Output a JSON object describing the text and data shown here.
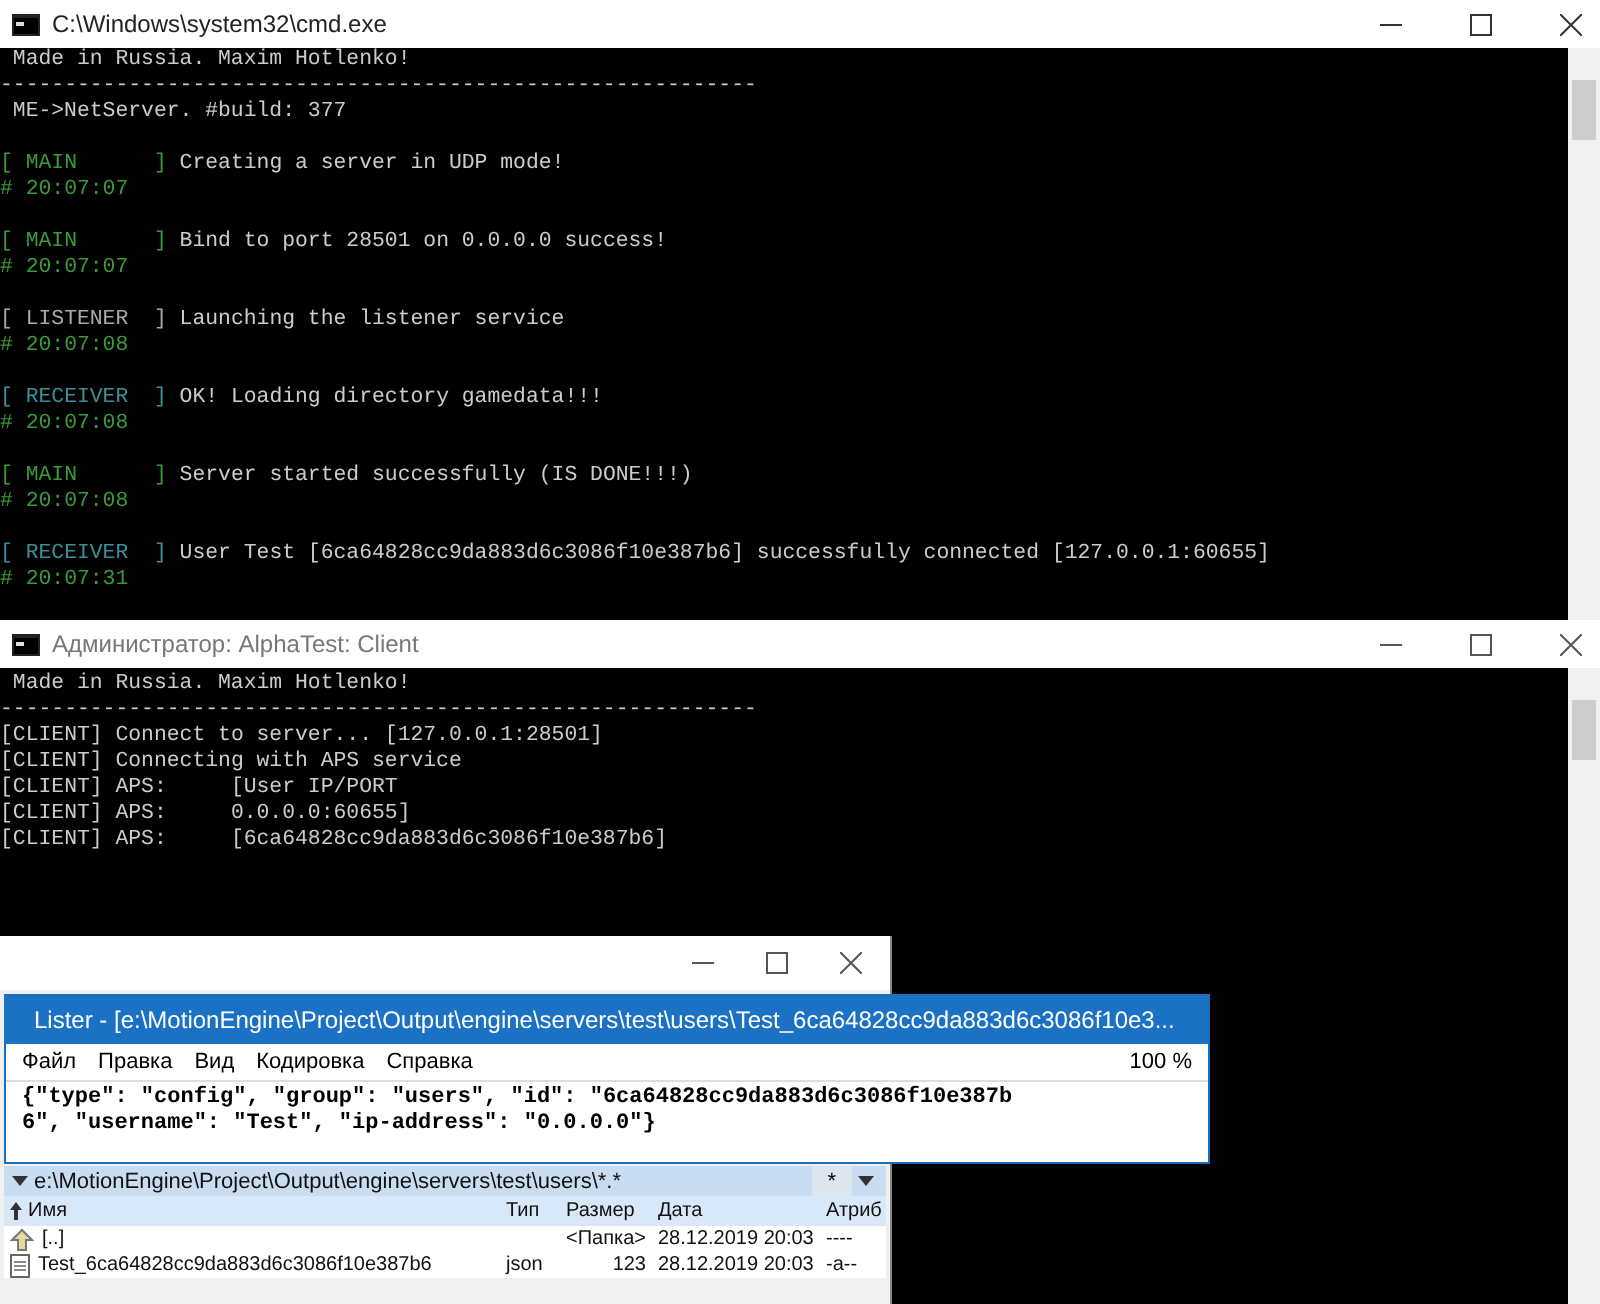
{
  "server_window": {
    "title": "C:\\Windows\\system32\\cmd.exe",
    "lines": [
      {
        "kind": "text",
        "text": "Made in Russia. Maxim Hotlenko!"
      },
      {
        "kind": "rule",
        "text": "-----------------------------------------------------------"
      },
      {
        "kind": "text",
        "text": "ME->NetServer. #build: 377"
      },
      {
        "kind": "log",
        "tag": "[ MAIN      ]",
        "color": "#3a9a3a",
        "message": "Creating a server in UDP mode!",
        "time": "# 20:07:07"
      },
      {
        "kind": "log",
        "tag": "[ MAIN      ]",
        "color": "#3a9a3a",
        "message": "Bind to port 28501 on 0.0.0.0 success!",
        "time": "# 20:07:07"
      },
      {
        "kind": "log",
        "tag": "[ LISTENER  ]",
        "color": "#a8a8a8",
        "message": "Launching the listener service",
        "time": "# 20:07:08"
      },
      {
        "kind": "log",
        "tag": "[ RECEIVER  ]",
        "color": "#3a8f9a",
        "message": "OK! Loading directory gamedata!!!",
        "time": "# 20:07:08"
      },
      {
        "kind": "log",
        "tag": "[ MAIN      ]",
        "color": "#3a9a3a",
        "message": "Server started successfully (IS DONE!!!)",
        "time": "# 20:07:08"
      },
      {
        "kind": "log",
        "tag": "[ RECEIVER  ]",
        "color": "#3a8f9a",
        "message": "User Test [6ca64828cc9da883d6c3086f10e387b6] successfully connected [127.0.0.1:60655]",
        "time": "# 20:07:31"
      }
    ]
  },
  "client_window": {
    "title": "Администратор:  AlphaTest: Client",
    "lines": [
      {
        "kind": "text",
        "text": "Made in Russia. Maxim Hotlenko!"
      },
      {
        "kind": "rule",
        "text": "-----------------------------------------------------------"
      },
      {
        "kind": "plain",
        "text": "[CLIENT] Connect to server... [127.0.0.1:28501]"
      },
      {
        "kind": "plain",
        "text": "[CLIENT] Connecting with APS service"
      },
      {
        "kind": "plain",
        "text": "[CLIENT] APS:     [User IP/PORT"
      },
      {
        "kind": "plain",
        "text": "[CLIENT] APS:     0.0.0.0:60655]"
      },
      {
        "kind": "plain",
        "text": "[CLIENT] APS:     [6ca64828cc9da883d6c3086f10e387b6]"
      }
    ]
  },
  "file_manager": {
    "path": "e:\\MotionEngine\\Project\\Output\\engine\\servers\\test\\users\\*.*",
    "filter_button": "*",
    "columns": [
      "Имя",
      "Тип",
      "Размер",
      "Дата",
      "Атриб"
    ],
    "rows": [
      {
        "kind": "up",
        "name": "[..]",
        "type": "",
        "size": "<Папка>",
        "date": "28.12.2019 20:03",
        "attributes": "----"
      },
      {
        "kind": "file",
        "name": "Test_6ca64828cc9da883d6c3086f10e387b6",
        "type": "json",
        "size": "123",
        "date": "28.12.2019 20:03",
        "attributes": "-a--"
      }
    ]
  },
  "lister": {
    "title": "Lister - [e:\\MotionEngine\\Project\\Output\\engine\\servers\\test\\users\\Test_6ca64828cc9da883d6c3086f10e3...",
    "menu": [
      "Файл",
      "Правка",
      "Вид",
      "Кодировка",
      "Справка"
    ],
    "zoom": "100 %",
    "content": [
      "{\"type\": \"config\", \"group\": \"users\", \"id\": \"6ca64828cc9da883d6c3086f10e387b",
      "6\", \"username\": \"Test\", \"ip-address\": \"0.0.0.0\"}"
    ]
  }
}
